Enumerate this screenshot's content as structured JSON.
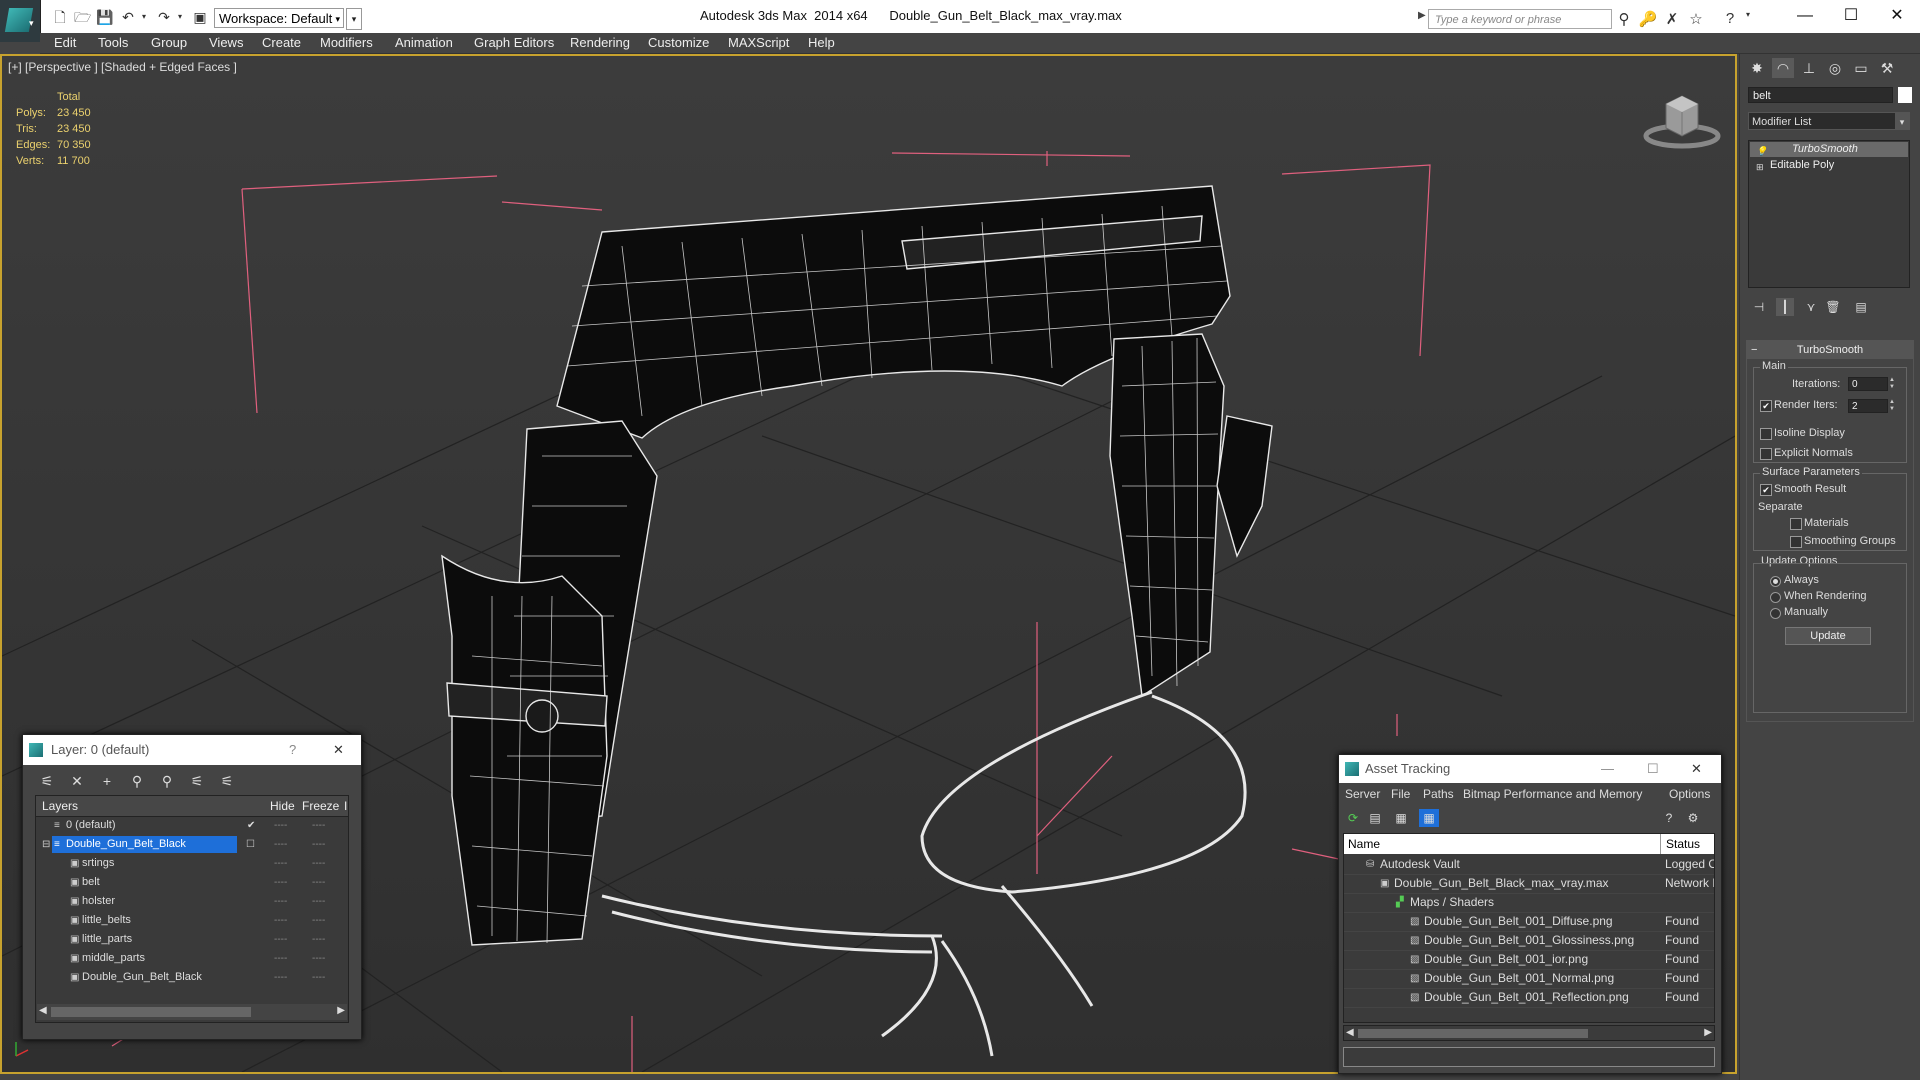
{
  "app": {
    "window_title": "Autodesk 3ds Max  2014 x64      Double_Gun_Belt_Black_max_vray.max",
    "workspace": "Workspace: Default",
    "search_placeholder": "Type a keyword or phrase"
  },
  "menu": [
    "Edit",
    "Tools",
    "Group",
    "Views",
    "Create",
    "Modifiers",
    "Animation",
    "Graph Editors",
    "Rendering",
    "Customize",
    "MAXScript",
    "Help"
  ],
  "viewport": {
    "label": "[+] [Perspective ] [Shaded + Edged Faces ]",
    "stats": {
      "header": "Total",
      "rows": [
        {
          "label": "Polys:",
          "value": "23 450"
        },
        {
          "label": "Tris:",
          "value": "23 450"
        },
        {
          "label": "Edges:",
          "value": "70 350"
        },
        {
          "label": "Verts:",
          "value": "11 700"
        }
      ]
    }
  },
  "command_panel": {
    "object_name": "belt",
    "modifier_list": "Modifier List",
    "stack": [
      "TurboSmooth",
      "Editable Poly"
    ],
    "rollout_title": "TurboSmooth",
    "main_group": "Main",
    "iterations_label": "Iterations:",
    "iterations_value": "0",
    "render_iters_label": "Render Iters:",
    "render_iters_value": "2",
    "render_iters_checked": true,
    "isoline_label": "Isoline Display",
    "explicit_normals_label": "Explicit Normals",
    "surface_group": "Surface Parameters",
    "smooth_result_label": "Smooth Result",
    "separate_label": "Separate",
    "materials_label": "Materials",
    "smoothing_groups_label": "Smoothing Groups",
    "update_group": "Update Options",
    "update_options": [
      "Always",
      "When Rendering",
      "Manually"
    ],
    "update_selected": "Always",
    "update_button": "Update"
  },
  "layer_dialog": {
    "title": "Layer: 0 (default)",
    "help": "?",
    "close": "✕",
    "col_layers": "Layers",
    "col_hide": "Hide",
    "col_freeze": "Freeze",
    "col_extra": "I",
    "rows": [
      {
        "name": "0 (default)",
        "level": 0,
        "type": "layer",
        "current": true
      },
      {
        "name": "Double_Gun_Belt_Black",
        "level": 0,
        "type": "layer",
        "selected": true
      },
      {
        "name": "srtings",
        "level": 1,
        "type": "object"
      },
      {
        "name": "belt",
        "level": 1,
        "type": "object"
      },
      {
        "name": "holster",
        "level": 1,
        "type": "object"
      },
      {
        "name": "little_belts",
        "level": 1,
        "type": "object"
      },
      {
        "name": "little_parts",
        "level": 1,
        "type": "object"
      },
      {
        "name": "middle_parts",
        "level": 1,
        "type": "object"
      },
      {
        "name": "Double_Gun_Belt_Black",
        "level": 1,
        "type": "object"
      }
    ],
    "dash": "----"
  },
  "asset_dialog": {
    "title": "Asset Tracking",
    "menu": [
      "Server",
      "File",
      "Paths",
      "Bitmap Performance and Memory",
      "Options"
    ],
    "col_name": "Name",
    "col_status": "Status",
    "rows": [
      {
        "name": "Autodesk Vault",
        "status": "Logged O",
        "level": 0
      },
      {
        "name": "Double_Gun_Belt_Black_max_vray.max",
        "status": "Network F",
        "level": 1
      },
      {
        "name": "Maps / Shaders",
        "status": "",
        "level": 2
      },
      {
        "name": "Double_Gun_Belt_001_Diffuse.png",
        "status": "Found",
        "level": 3
      },
      {
        "name": "Double_Gun_Belt_001_Glossiness.png",
        "status": "Found",
        "level": 3
      },
      {
        "name": "Double_Gun_Belt_001_ior.png",
        "status": "Found",
        "level": 3
      },
      {
        "name": "Double_Gun_Belt_001_Normal.png",
        "status": "Found",
        "level": 3
      },
      {
        "name": "Double_Gun_Belt_001_Reflection.png",
        "status": "Found",
        "level": 3
      }
    ]
  },
  "colors": {
    "viewport_border": "#c7a22e",
    "stats_text": "#ebd16e",
    "selection": "#1e6fd9",
    "bbox_lines": "#e0607e"
  }
}
